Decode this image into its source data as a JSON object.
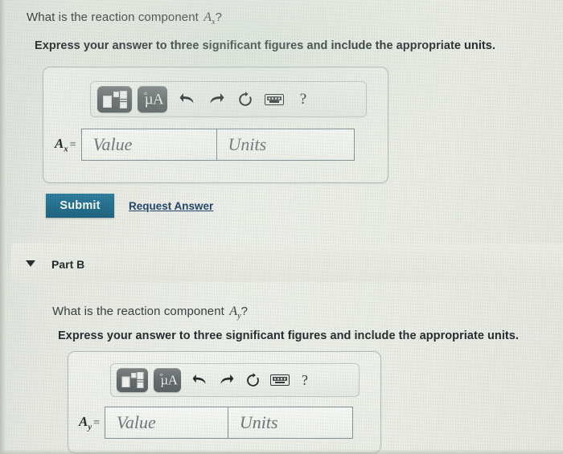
{
  "part_a": {
    "question_prefix": "What is the reaction component ",
    "question_var": "A",
    "question_sub": "x",
    "question_suffix": "?",
    "instruction": "Express your answer to three significant figures and include the appropriate units.",
    "toolbar": {
      "template_button": "math-template",
      "units_button": "µÅ",
      "units_mu": "µA",
      "units_ring": "°",
      "undo_button": "undo",
      "redo_button": "redo",
      "reset_button": "reset",
      "keyboard_button": "keyboard",
      "help_button": "?"
    },
    "variable_label": "A",
    "variable_sub": "x",
    "equals": "=",
    "value_placeholder": "Value",
    "units_placeholder": "Units",
    "submit_label": "Submit",
    "request_answer_label": "Request Answer"
  },
  "part_b_header": {
    "caret": "collapse-caret",
    "title": "Part B"
  },
  "part_b": {
    "question_prefix": "What is the reaction component ",
    "question_var": "A",
    "question_sub": "y",
    "question_suffix": "?",
    "instruction": "Express your answer to three significant figures and include the appropriate units.",
    "toolbar": {
      "template_button": "math-template",
      "units_button": "µÅ",
      "units_mu": "µA",
      "units_ring": "°",
      "undo_button": "undo",
      "redo_button": "redo",
      "reset_button": "reset",
      "keyboard_button": "keyboard",
      "help_button": "?"
    },
    "variable_label": "A",
    "variable_sub": "y",
    "equals": "=",
    "value_placeholder": "Value",
    "units_placeholder": "Units"
  },
  "colors": {
    "submit_bg": "#1d6b8b",
    "link": "#1f3f6b",
    "page_bg": "#eceee7",
    "field_border": "#7e8f97",
    "toolbar_btn": "#62686a"
  }
}
